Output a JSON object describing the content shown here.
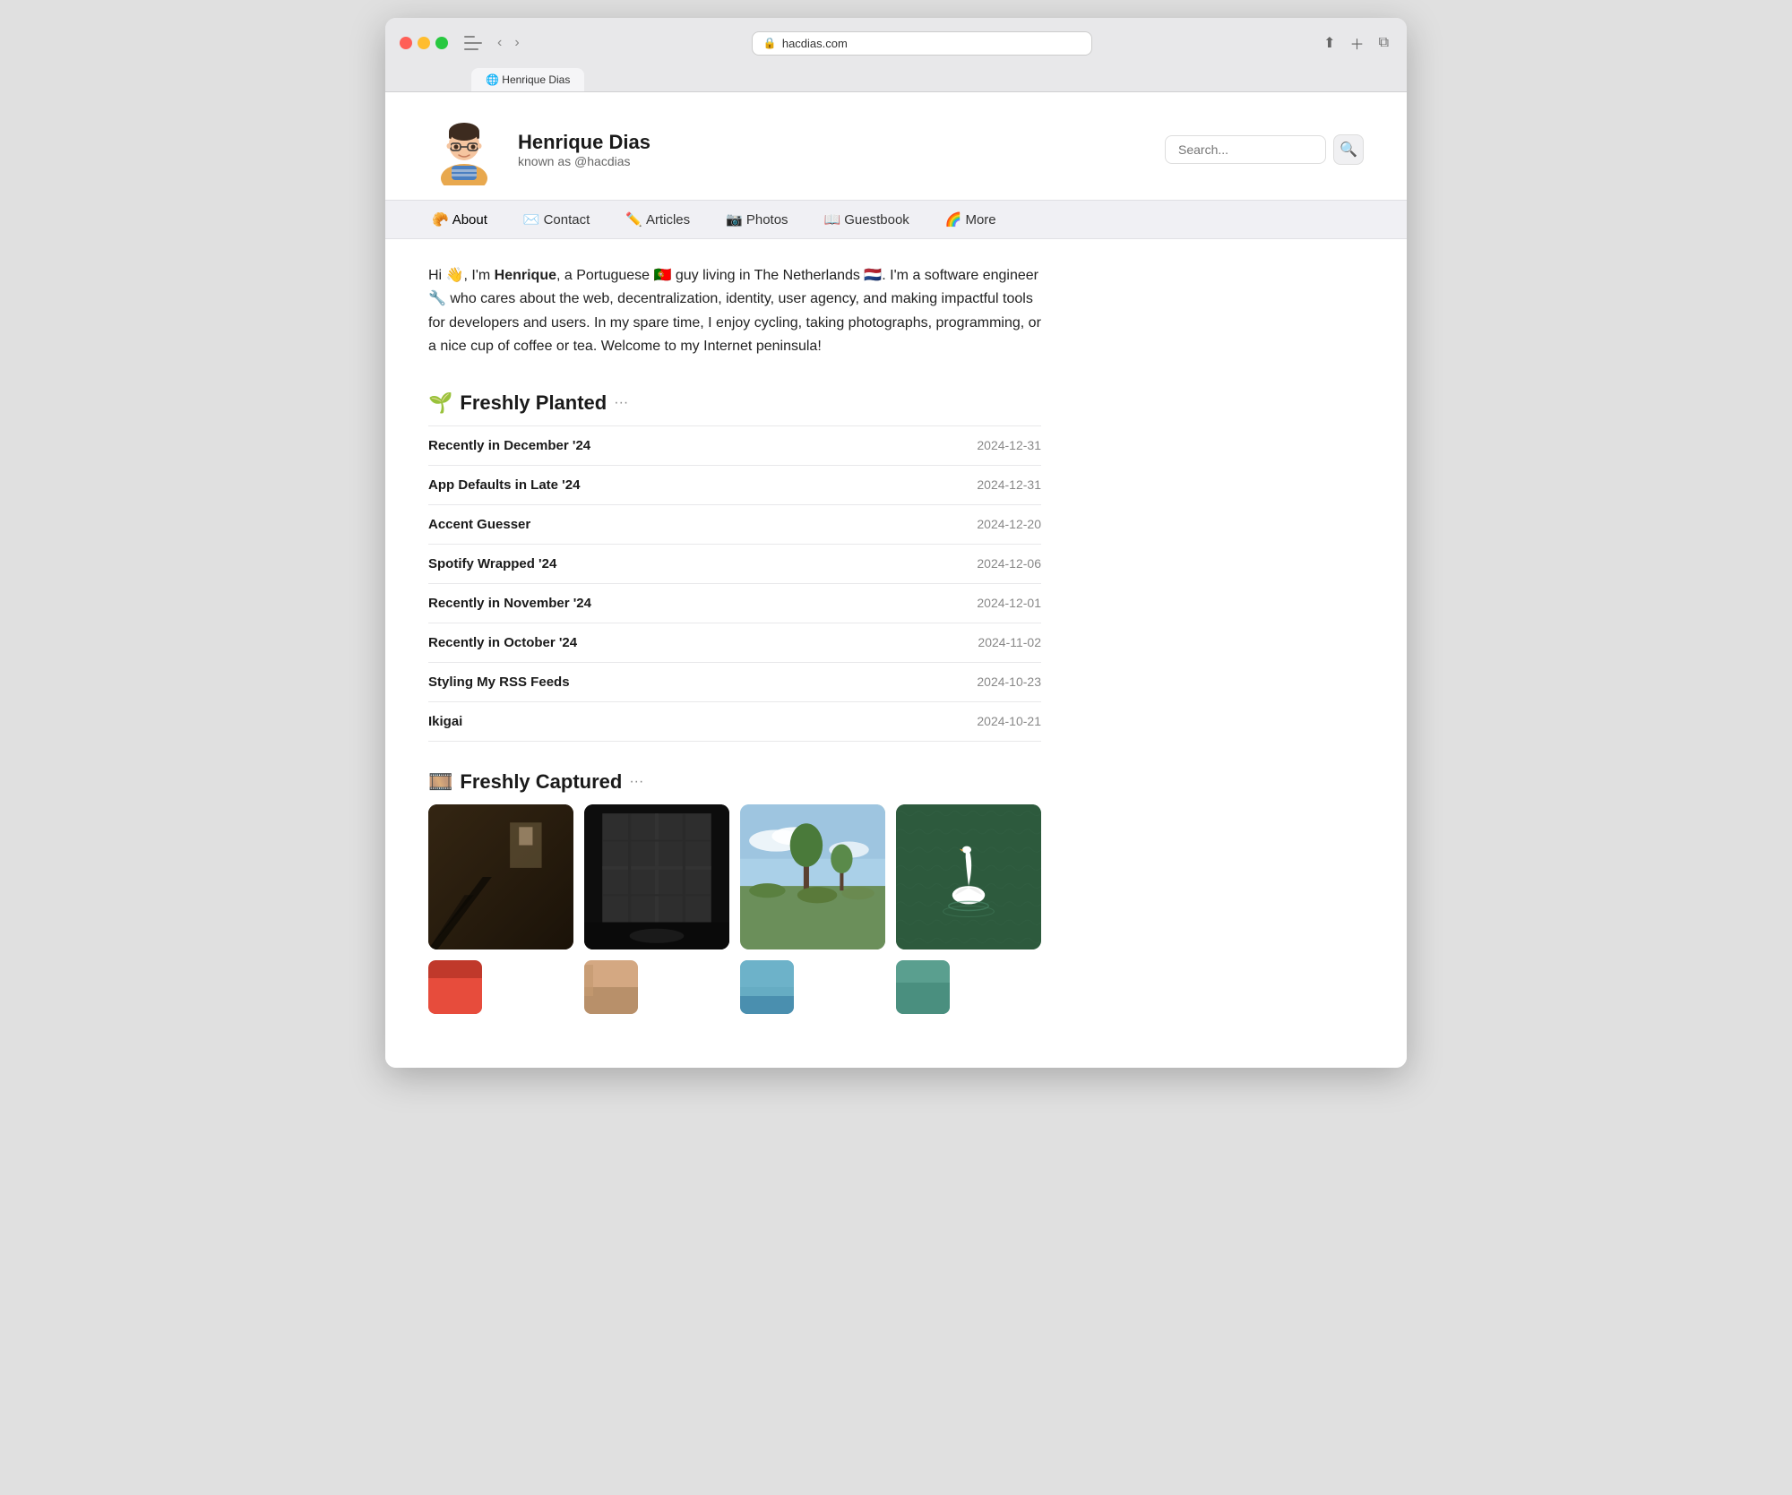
{
  "browser": {
    "url": "hacdias.com",
    "tab_title": "Henrique Dias",
    "tab_icon": "🌐"
  },
  "header": {
    "name": "Henrique Dias",
    "handle": "known as @hacdias",
    "search_placeholder": "Search..."
  },
  "nav": {
    "items": [
      {
        "label": "About",
        "emoji": "🥐",
        "active": true
      },
      {
        "label": "Contact",
        "emoji": "✉️"
      },
      {
        "label": "Articles",
        "emoji": "✏️"
      },
      {
        "label": "Photos",
        "emoji": "📷"
      },
      {
        "label": "Guestbook",
        "emoji": "📖"
      },
      {
        "label": "More",
        "emoji": "🌈"
      }
    ]
  },
  "bio": {
    "text_parts": [
      "Hi 👋, I'm ",
      "Henrique",
      ", a Portuguese 🇵🇹 guy living in The Netherlands 🇳🇱. I'm a software engineer 🔧 who cares about the web, decentralization, identity, user agency, and making impactful tools for developers and users. In my spare time, I enjoy cycling, taking photographs, programming, or a nice cup of coffee or tea. Welcome to my Internet peninsula!"
    ]
  },
  "freshly_planted": {
    "title": "Freshly Planted",
    "emoji": "🌱",
    "more": "···",
    "articles": [
      {
        "title": "Recently in December '24",
        "date": "2024-12-31"
      },
      {
        "title": "App Defaults in Late '24",
        "date": "2024-12-31"
      },
      {
        "title": "Accent Guesser",
        "date": "2024-12-20"
      },
      {
        "title": "Spotify Wrapped '24",
        "date": "2024-12-06"
      },
      {
        "title": "Recently in November '24",
        "date": "2024-12-01"
      },
      {
        "title": "Recently in October '24",
        "date": "2024-11-02"
      },
      {
        "title": "Styling My RSS Feeds",
        "date": "2024-10-23"
      },
      {
        "title": "Ikigai",
        "date": "2024-10-21"
      }
    ]
  },
  "freshly_captured": {
    "title": "Freshly Captured",
    "emoji": "🎞️",
    "more": "···",
    "photos": [
      {
        "alt": "Dark room with wooden stairs and window light",
        "class": "photo-1"
      },
      {
        "alt": "Black and white room with large windows",
        "class": "photo-2"
      },
      {
        "alt": "Outdoor nature scene with trees and sky",
        "class": "photo-3"
      },
      {
        "alt": "Swan on green water from above",
        "class": "photo-4"
      }
    ],
    "photos_bottom": [
      {
        "alt": "Red and orange abstract",
        "class": "photo-5"
      },
      {
        "alt": "Warm tones photo",
        "class": "photo-6"
      },
      {
        "alt": "Blue toned photo",
        "class": "photo-7"
      },
      {
        "alt": "Teal toned photo",
        "class": "photo-8"
      }
    ]
  },
  "icons": {
    "back": "‹",
    "forward": "›",
    "share": "⬆",
    "new_tab": "+",
    "tabs": "⊞",
    "lock": "🔒",
    "search": "🔍"
  }
}
